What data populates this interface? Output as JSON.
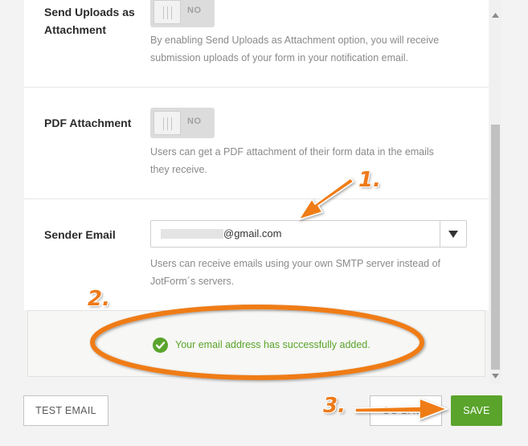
{
  "settings": {
    "send_uploads": {
      "label": "Send Uploads as Attachment",
      "state": "NO",
      "help": "By enabling Send Uploads as Attachment option, you will receive submission uploads of your form in your notification email."
    },
    "pdf_attachment": {
      "label": "PDF Attachment",
      "state": "NO",
      "help": "Users can get a PDF attachment of their form data in the emails they receive."
    },
    "sender_email": {
      "label": "Sender Email",
      "value": "@gmail.com",
      "help": "Users can receive emails using your own SMTP server instead of JotForm´s servers."
    }
  },
  "message": {
    "text": "Your email address has successfully added.",
    "icon": "check-circle-icon",
    "color": "#5aa42c"
  },
  "buttons": {
    "test_email": "TEST EMAIL",
    "back": "GO BACK",
    "save": "SAVE"
  },
  "annotations": {
    "step1": "1.",
    "step2": "2.",
    "step3": "3.",
    "color": "#ee7a1a"
  }
}
